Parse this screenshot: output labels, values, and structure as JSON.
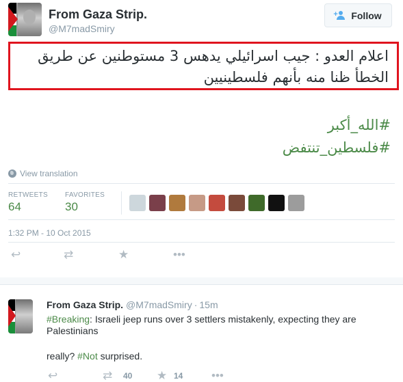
{
  "tweet": {
    "display_name": "From Gaza Strip.",
    "handle": "@M7madSmiry",
    "follow_label": "Follow",
    "arabic_text": "اعلام العدو : جيب اسرائيلي يدهس 3 مستوطنين عن طريق الخطأ ظنا منه بأنهم فلسطينيين",
    "hashtags": [
      "#الله_أكبر",
      "#فلسطين_تنتفض"
    ],
    "view_translation": "View translation",
    "stats": {
      "retweets_label": "RETWEETS",
      "retweets_value": "64",
      "favorites_label": "FAVORITES",
      "favorites_value": "30"
    },
    "favoriter_avatar_colors": [
      "#cdd7dc",
      "#7a3f4a",
      "#b07a3d",
      "#c69a86",
      "#c44b3e",
      "#7a4a3a",
      "#3f6a2a",
      "#111111",
      "#9c9c9c"
    ],
    "timestamp": "1:32 PM - 10 Oct 2015",
    "actions": {
      "reply_icon": "reply-icon",
      "retweet_icon": "retweet-icon",
      "favorite_icon": "star-icon",
      "more_icon": "more-icon"
    }
  },
  "reply": {
    "display_name": "From Gaza Strip.",
    "handle": "@M7madSmiry",
    "dot": "·",
    "time": "15m",
    "text_tag": "#Breaking",
    "text_body": ": Israeli jeep runs over 3 settlers mistakenly, expecting they are Palestinians",
    "text2_prefix": "really? ",
    "text2_tag": "#Not",
    "text2_suffix": " surprised.",
    "retweet_count": "40",
    "favorite_count": "14"
  },
  "colors": {
    "hashtag_green": "#4b8a48",
    "highlight_red": "#e0141e",
    "muted": "#8899a6",
    "follow_blue": "#55acee"
  }
}
